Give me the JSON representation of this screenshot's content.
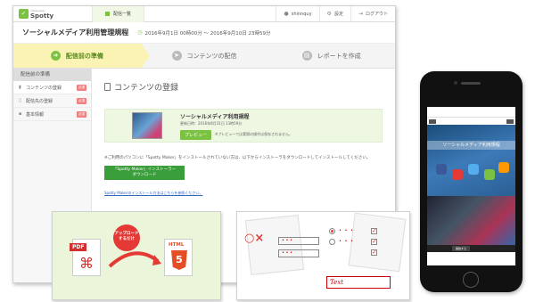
{
  "app": {
    "logo_small": "Infoanswer",
    "logo_name": "Spotty"
  },
  "topnav": {
    "tab_label": "配信一覧",
    "user": "shinnquy",
    "settings": "設定",
    "logout": "ログアウト"
  },
  "page": {
    "title": "ソーシャルメディア利用管理規程",
    "period": "2016年9月1日 00時00分 〜 2016年9月10日 23時59分"
  },
  "steps": [
    {
      "label": "配信前の準備"
    },
    {
      "label": "コンテンツの配信"
    },
    {
      "label": "レポートを作成"
    }
  ],
  "sidebar": {
    "header": "配信前の準備",
    "items": [
      {
        "label": "コンテンツの登録",
        "badge": "必須"
      },
      {
        "label": "配信先の登録",
        "badge": "必須"
      },
      {
        "label": "基本情報",
        "badge": "必須"
      }
    ]
  },
  "main": {
    "heading": "コンテンツの登録",
    "content_name": "ソーシャルメディア利用規程",
    "updated": "更新日時：2016年8月31日 13時59分",
    "preview_button": "プレビュー",
    "preview_note": "※プレビューでは実際の操作は保存されません。",
    "info_text": "※ご利用のパソコンに「Spotty Maker」をインストールされていない方は、以下からインストーラをダウンロードしてインストールしてください。",
    "download_line1": "「Spotty Maker」インストーラー",
    "download_line2": "ダウンロード",
    "link_text": "Spotty Makerのインストール方法はこちらを参照ください。"
  },
  "overlay_pdf": {
    "pdf_label": "PDF",
    "bubble_line1": "アップロード",
    "bubble_line2": "するだけ",
    "html_label": "HTML"
  },
  "overlay_quiz": {
    "text_label": "Text",
    "ox": "○×"
  },
  "phone": {
    "screen_title": "ソーシャルメディア利用規程",
    "nav_button": "開始する"
  },
  "colors": {
    "accent": "#7cc242",
    "active_step": "#fbf3b4",
    "badge": "#f08080",
    "download": "#3a9e3a"
  }
}
